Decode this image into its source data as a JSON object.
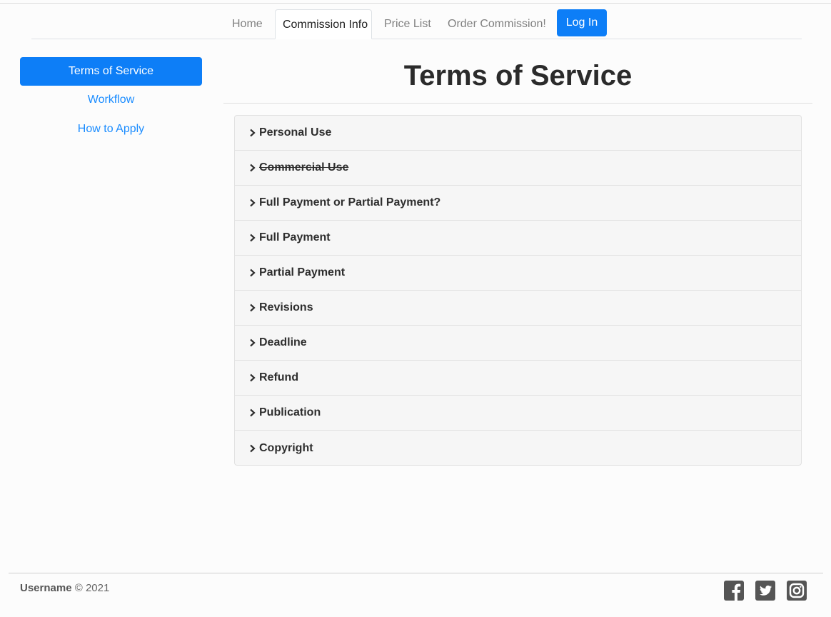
{
  "nav": {
    "items": [
      {
        "label": "Home"
      },
      {
        "label": "Commission Info"
      },
      {
        "label": "Price List"
      },
      {
        "label": "Order Commission!"
      }
    ],
    "login_label": "Log In"
  },
  "sidebar": {
    "items": [
      {
        "label": "Terms of Service"
      },
      {
        "label": "Workflow"
      },
      {
        "label": "How to Apply"
      }
    ]
  },
  "main": {
    "title": "Terms of Service",
    "sections": [
      {
        "label": "Personal Use"
      },
      {
        "label": "Commercial Use"
      },
      {
        "label": "Full Payment or Partial Payment?"
      },
      {
        "label": "Full Payment"
      },
      {
        "label": "Partial Payment"
      },
      {
        "label": "Revisions"
      },
      {
        "label": "Deadline"
      },
      {
        "label": "Refund"
      },
      {
        "label": "Publication"
      },
      {
        "label": "Copyright"
      }
    ]
  },
  "footer": {
    "username": "Username",
    "copyright": "© 2021",
    "social": [
      "facebook-icon",
      "twitter-icon",
      "instagram-icon"
    ]
  },
  "colors": {
    "accent": "#0d7ef7",
    "link": "#1a8cff"
  }
}
